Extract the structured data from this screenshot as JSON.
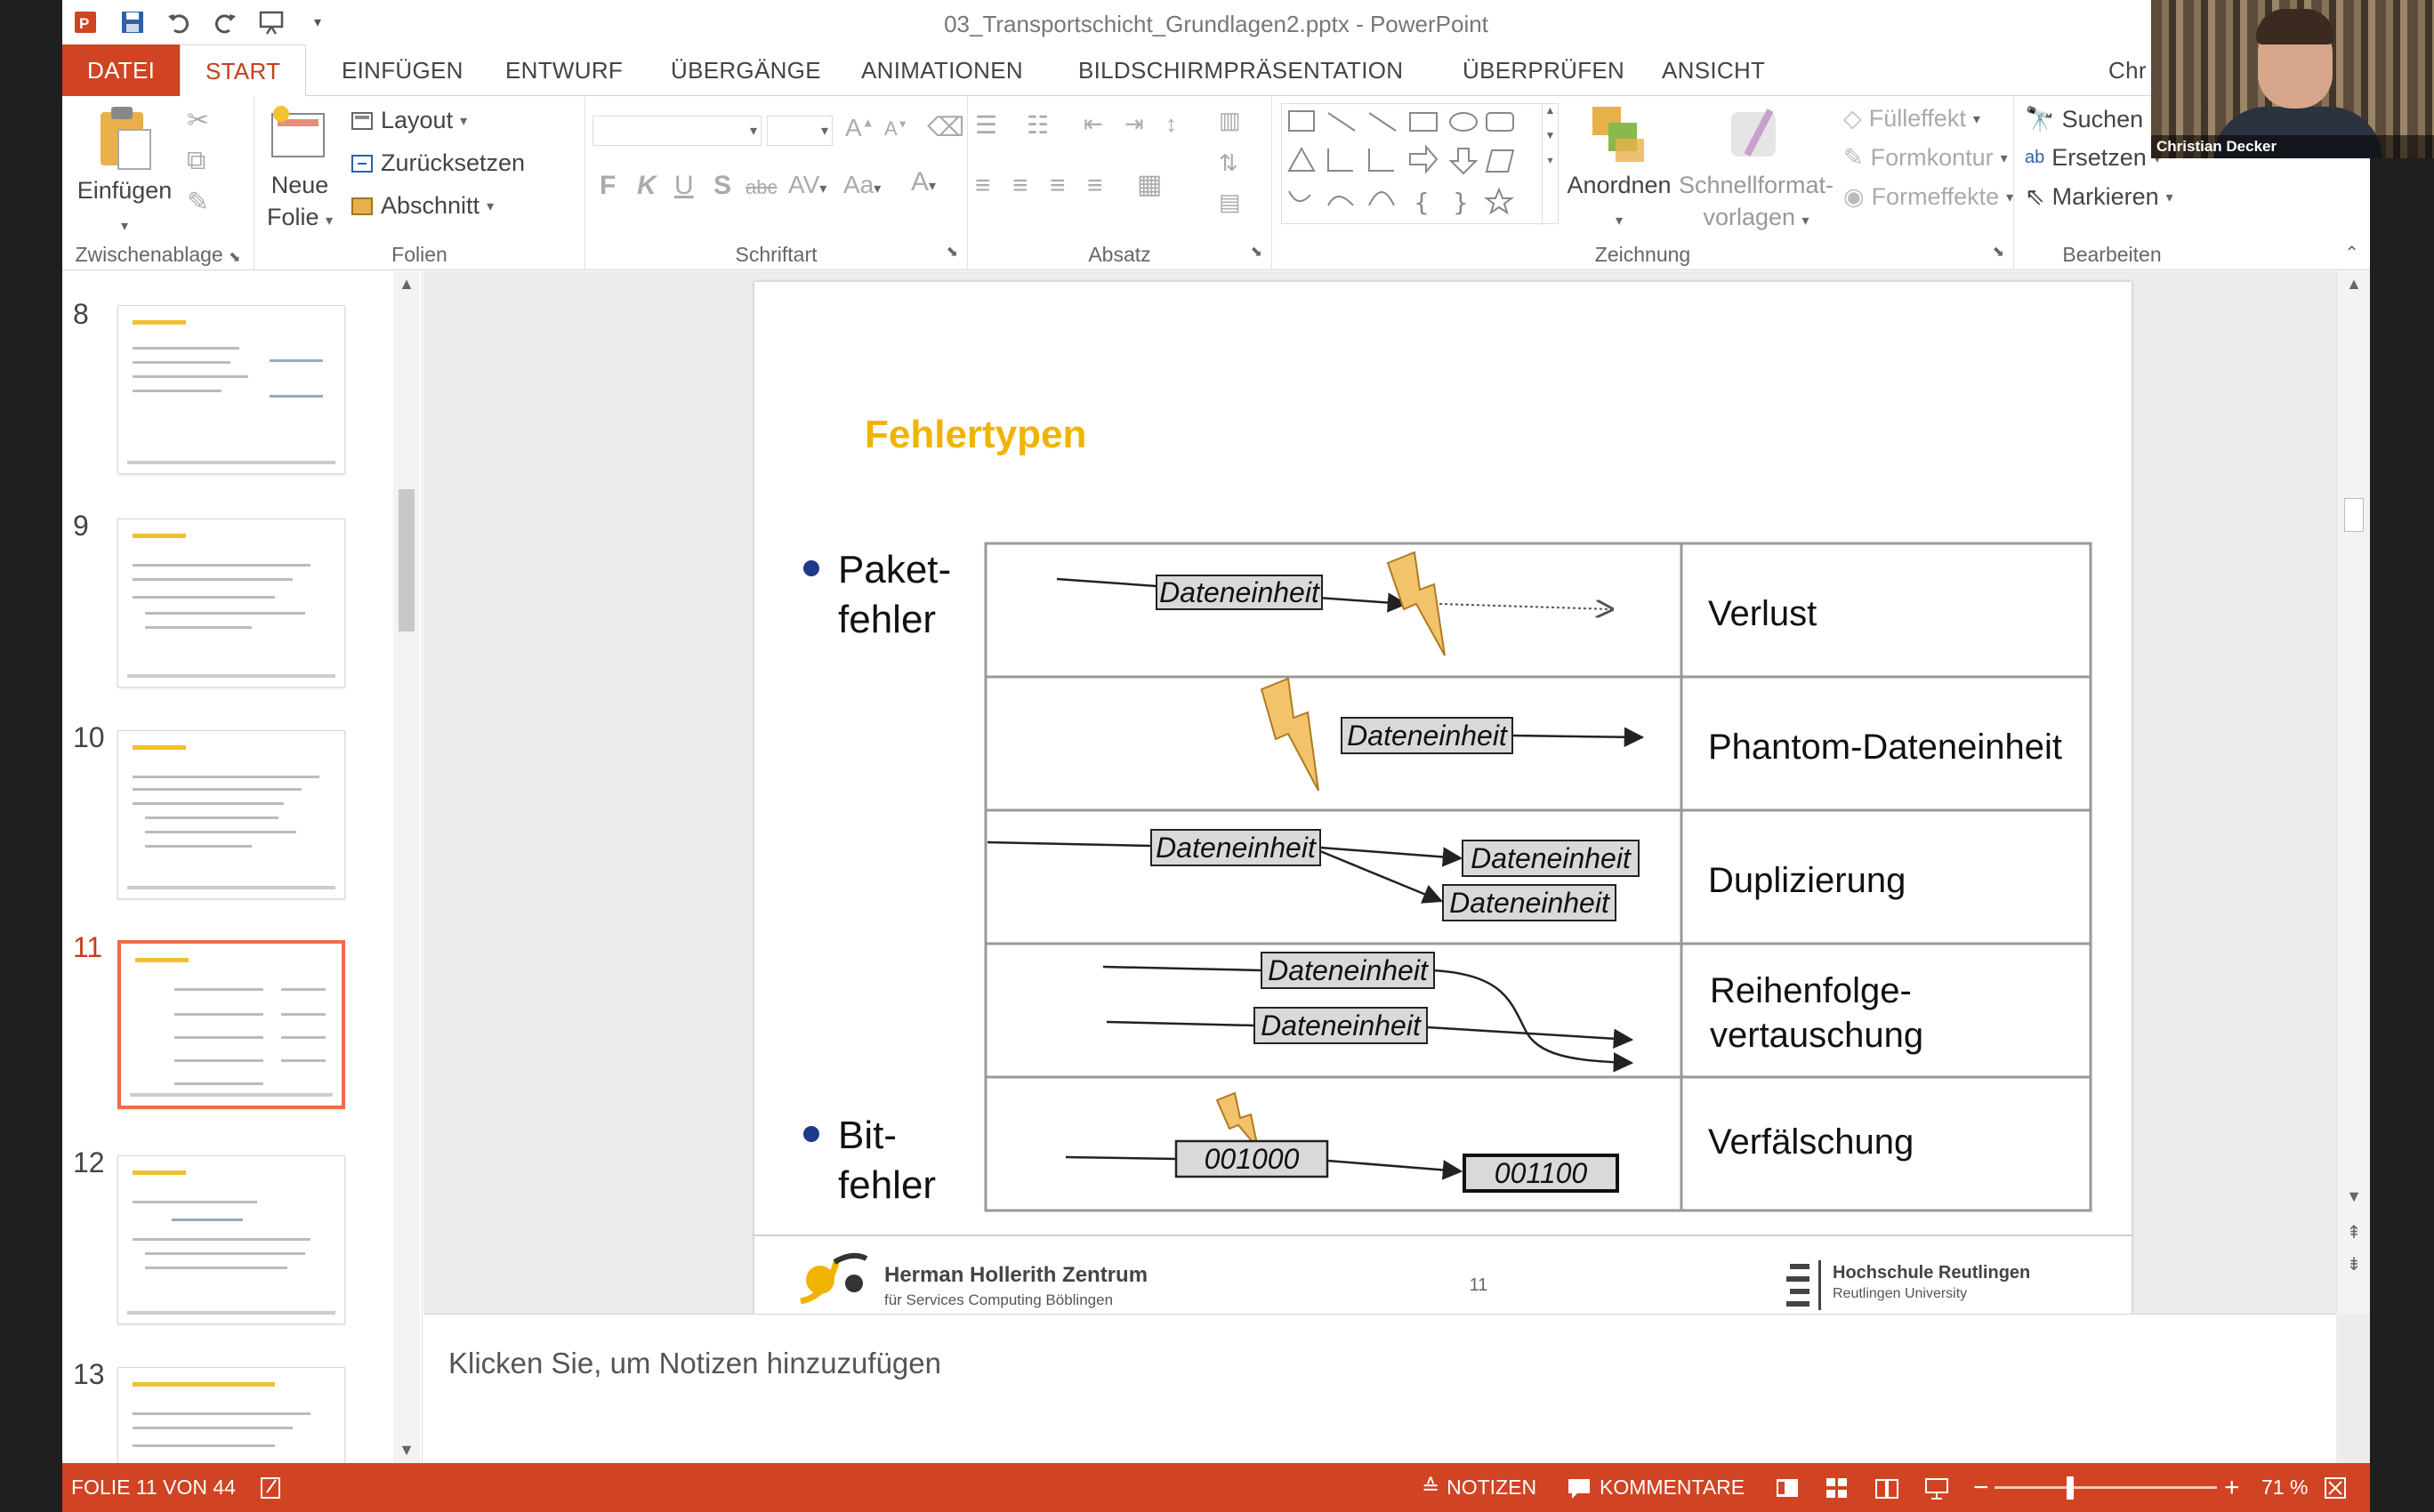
{
  "window": {
    "title": "03_Transportschicht_Grundlagen2.pptx - PowerPoint"
  },
  "tabs": [
    {
      "label": "DATEI"
    },
    {
      "label": "START"
    },
    {
      "label": "EINFÜGEN"
    },
    {
      "label": "ENTWURF"
    },
    {
      "label": "ÜBERGÄNGE"
    },
    {
      "label": "ANIMATIONEN"
    },
    {
      "label": "BILDSCHIRMPRÄSENTATION"
    },
    {
      "label": "ÜBERPRÜFEN"
    },
    {
      "label": "ANSICHT"
    },
    {
      "label": "Chr"
    }
  ],
  "ribbon": {
    "clipboard": {
      "paste": "Einfügen",
      "label": "Zwischenablage"
    },
    "slides": {
      "new_slide_1": "Neue",
      "new_slide_2": "Folie",
      "layout": "Layout",
      "reset": "Zurücksetzen",
      "section": "Abschnitt",
      "label": "Folien"
    },
    "font": {
      "bold": "F",
      "italic": "K",
      "underline": "U",
      "shadow": "S",
      "strike": "abc",
      "spacing": "AV",
      "case": "Aa",
      "color": "A",
      "grow": "A",
      "shrink": "A",
      "label": "Schriftart"
    },
    "paragraph": {
      "label": "Absatz"
    },
    "drawing": {
      "arrange": "Anordnen",
      "quickstyles_1": "Schnellformat-",
      "quickstyles_2": "vorlagen",
      "fill": "Fülleffekt",
      "outline": "Formkontur",
      "effects": "Formeffekte",
      "label": "Zeichnung"
    },
    "editing": {
      "find": "Suchen",
      "replace": "Ersetzen",
      "select": "Markieren",
      "label": "Bearbeiten"
    }
  },
  "webcam": {
    "name": "Christian Decker"
  },
  "thumbnails": [
    {
      "number": "8"
    },
    {
      "number": "9"
    },
    {
      "number": "10"
    },
    {
      "number": "11",
      "active": true
    },
    {
      "number": "12"
    },
    {
      "number": "13"
    }
  ],
  "slide": {
    "title": "Fehlertypen",
    "bullet_1_line1": "Paket-",
    "bullet_1_line2": "fehler",
    "bullet_2_line1": "Bit-",
    "bullet_2_line2": "fehler",
    "unit": "Dateneinheit",
    "rows": [
      {
        "label_1": "Verlust",
        "label_2": ""
      },
      {
        "label_1": "Phantom-Dateneinheit",
        "label_2": ""
      },
      {
        "label_1": "Duplizierung",
        "label_2": ""
      },
      {
        "label_1": "Reihenfolge-",
        "label_2": "vertauschung"
      },
      {
        "label_1": "Verfälschung",
        "label_2": ""
      }
    ],
    "bits_before": "001000",
    "bits_after": "001100",
    "footer_org_1": "Herman Hollerith Zentrum",
    "footer_org_2": "für Services Computing Böblingen",
    "page_number": "11",
    "footer_uni_1": "Hochschule Reutlingen",
    "footer_uni_2": "Reutlingen University",
    "colors": {
      "title": "#f0b400",
      "bullet": "#1f3a8a",
      "flash": "#f2c36b",
      "box": "#d9d9d9"
    }
  },
  "notes": {
    "placeholder": "Klicken Sie, um Notizen hinzuzufügen"
  },
  "status": {
    "slide_info": "FOLIE 11 VON 44",
    "notes": "NOTIZEN",
    "comments": "KOMMENTARE",
    "zoom": "71 %",
    "zoom_percent": 71
  }
}
